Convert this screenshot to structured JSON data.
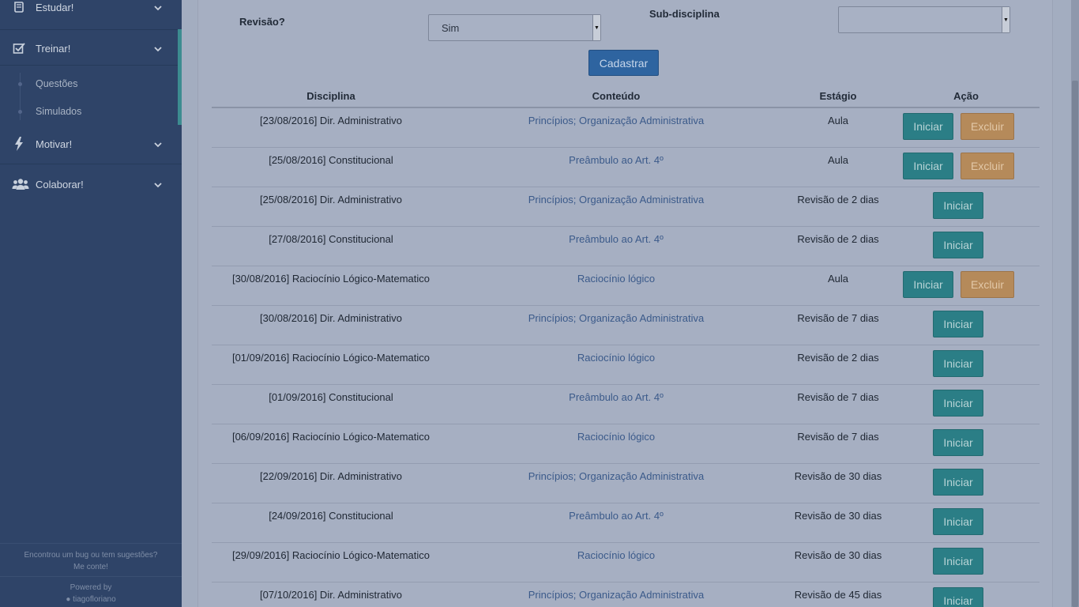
{
  "sidebar": {
    "items": [
      {
        "label": "Estudar!",
        "icon": "book-icon"
      },
      {
        "label": "Treinar!",
        "icon": "checkbox-icon"
      },
      {
        "label": "Motivar!",
        "icon": "bolt-icon"
      },
      {
        "label": "Colaborar!",
        "icon": "users-icon"
      }
    ],
    "subitems": [
      {
        "label": "Questões"
      },
      {
        "label": "Simulados"
      }
    ],
    "footer": {
      "line1": "Encontrou um bug ou tem sugestões?",
      "line2": "Me conte!",
      "powered": "Powered by",
      "author": "tiagofloriano"
    }
  },
  "form": {
    "revisao_label": "Revisão?",
    "revisao_value": "Sim",
    "subdisciplina_label": "Sub-disciplina",
    "subdisciplina_value": "",
    "submit_label": "Cadastrar"
  },
  "table": {
    "headers": [
      "Disciplina",
      "Conteúdo",
      "Estágio",
      "Ação"
    ],
    "rows": [
      {
        "disciplina": "[23/08/2016] Dir. Administrativo",
        "conteudo": "Princípios; Organização Administrativa",
        "estagio": "Aula",
        "iniciar": "Iniciar",
        "excluir": "Excluir"
      },
      {
        "disciplina": "[25/08/2016] Constitucional",
        "conteudo": "Preâmbulo ao Art. 4º",
        "estagio": "Aula",
        "iniciar": "Iniciar",
        "excluir": "Excluir"
      },
      {
        "disciplina": "[25/08/2016] Dir. Administrativo",
        "conteudo": "Princípios; Organização Administrativa",
        "estagio": "Revisão de 2 dias",
        "iniciar": "Iniciar"
      },
      {
        "disciplina": "[27/08/2016] Constitucional",
        "conteudo": "Preâmbulo ao Art. 4º",
        "estagio": "Revisão de 2 dias",
        "iniciar": "Iniciar"
      },
      {
        "disciplina": "[30/08/2016] Raciocínio Lógico-Matematico",
        "conteudo": "Raciocínio lógico",
        "estagio": "Aula",
        "iniciar": "Iniciar",
        "excluir": "Excluir"
      },
      {
        "disciplina": "[30/08/2016] Dir. Administrativo",
        "conteudo": "Princípios; Organização Administrativa",
        "estagio": "Revisão de 7 dias",
        "iniciar": "Iniciar"
      },
      {
        "disciplina": "[01/09/2016] Raciocínio Lógico-Matematico",
        "conteudo": "Raciocínio lógico",
        "estagio": "Revisão de 2 dias",
        "iniciar": "Iniciar"
      },
      {
        "disciplina": "[01/09/2016] Constitucional",
        "conteudo": "Preâmbulo ao Art. 4º",
        "estagio": "Revisão de 7 dias",
        "iniciar": "Iniciar"
      },
      {
        "disciplina": "[06/09/2016] Raciocínio Lógico-Matematico",
        "conteudo": "Raciocínio lógico",
        "estagio": "Revisão de 7 dias",
        "iniciar": "Iniciar"
      },
      {
        "disciplina": "[22/09/2016] Dir. Administrativo",
        "conteudo": "Princípios; Organização Administrativa",
        "estagio": "Revisão de 30 dias",
        "iniciar": "Iniciar"
      },
      {
        "disciplina": "[24/09/2016] Constitucional",
        "conteudo": "Preâmbulo ao Art. 4º",
        "estagio": "Revisão de 30 dias",
        "iniciar": "Iniciar"
      },
      {
        "disciplina": "[29/09/2016] Raciocínio Lógico-Matematico",
        "conteudo": "Raciocínio lógico",
        "estagio": "Revisão de 30 dias",
        "iniciar": "Iniciar"
      },
      {
        "disciplina": "[07/10/2016] Dir. Administrativo",
        "conteudo": "Princípios; Organização Administrativa",
        "estagio": "Revisão de 45 dias",
        "iniciar": "Iniciar"
      }
    ]
  },
  "colors": {
    "sidebar": "#2f4468",
    "primary": "#2e64a0",
    "info": "#2b7e86",
    "warning": "#b58a5a",
    "active_accent": "#3c8c90"
  }
}
